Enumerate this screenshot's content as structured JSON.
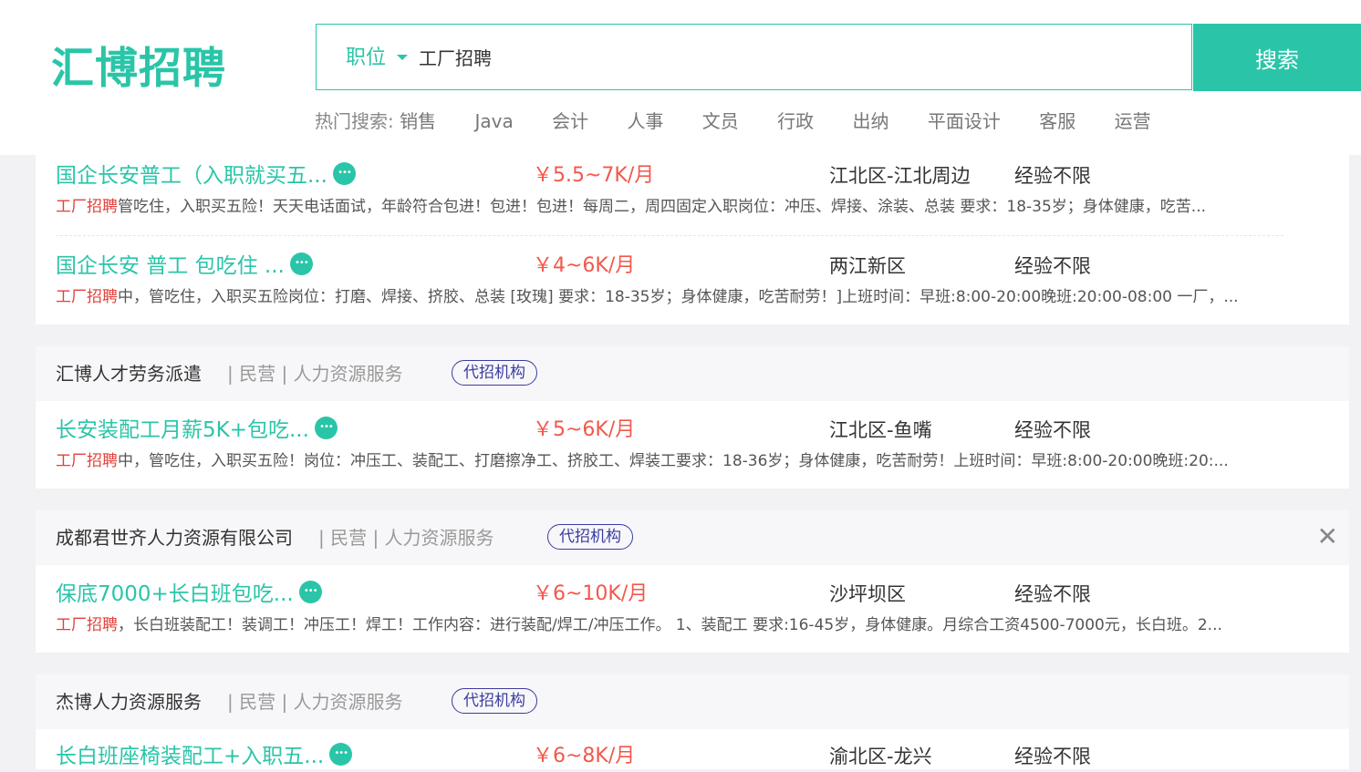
{
  "header": {
    "logo": "汇博招聘",
    "search": {
      "category": "职位",
      "query": "工厂招聘",
      "button": "搜索"
    },
    "hot_label": "热门搜索:",
    "hot_tags": [
      "销售",
      "Java",
      "会计",
      "人事",
      "文员",
      "行政",
      "出纳",
      "平面设计",
      "客服",
      "运营"
    ]
  },
  "listing": {
    "card0": {
      "jobs": [
        {
          "title": "国企长安普工（入职就买五...",
          "salary": "￥5.5~7K/月",
          "location": "江北区-江北周边",
          "experience": "经验不限",
          "keyword": "工厂招聘",
          "desc": "管吃住，入职买五险！天天电话面试，年龄符合包进！包进！包进！每周二，周四固定入职岗位：冲压、焊接、涂装、总装 要求：18-35岁；身体健康，吃苦..."
        },
        {
          "title": "国企长安 普工 包吃住 ...",
          "salary": "￥4~6K/月",
          "location": "两江新区",
          "experience": "经验不限",
          "keyword": "工厂招聘",
          "desc": "中，管吃住，入职买五险岗位：打磨、焊接、挤胶、总装 [玫瑰] 要求：18-35岁；身体健康，吃苦耐劳！]上班时间：早班:8:00-20:00晚班:20:00-08:00 一厂，..."
        }
      ]
    },
    "card1": {
      "company": "汇博人才劳务派遣",
      "meta": "| 民营 | 人力资源服务",
      "badge": "代招机构",
      "jobs": [
        {
          "title": "长安装配工月薪5K+包吃...",
          "salary": "￥5~6K/月",
          "location": "江北区-鱼嘴",
          "experience": "经验不限",
          "keyword": "工厂招聘",
          "desc": "中，管吃住，入职买五险！岗位：冲压工、装配工、打磨擦净工、挤胶工、焊装工要求：18-36岁；身体健康，吃苦耐劳！上班时间：早班:8:00-20:00晚班:20:..."
        }
      ]
    },
    "card2": {
      "company": "成都君世齐人力资源有限公司",
      "meta": "| 民营 | 人力资源服务",
      "badge": "代招机构",
      "close": "✕",
      "jobs": [
        {
          "title": "保底7000+长白班包吃...",
          "salary": "￥6~10K/月",
          "location": "沙坪坝区",
          "experience": "经验不限",
          "keyword": "工厂招聘",
          "desc": "，长白班装配工！装调工！冲压工！焊工！工作内容：进行装配/焊工/冲压工作。 1、装配工 要求:16-45岁，身体健康。月综合工资4500-7000元，长白班。2..."
        }
      ]
    },
    "card3": {
      "company": "杰博人力资源服务",
      "meta": "| 民营 | 人力资源服务",
      "badge": "代招机构",
      "jobs": [
        {
          "title": "长白班座椅装配工+入职五...",
          "salary": "￥6~8K/月",
          "location": "渝北区-龙兴",
          "experience": "经验不限"
        }
      ]
    }
  },
  "colors": {
    "brand": "#2ac5a8",
    "salary": "#f2584b",
    "keyword": "#e2403a",
    "badge": "#3b3ba0"
  }
}
